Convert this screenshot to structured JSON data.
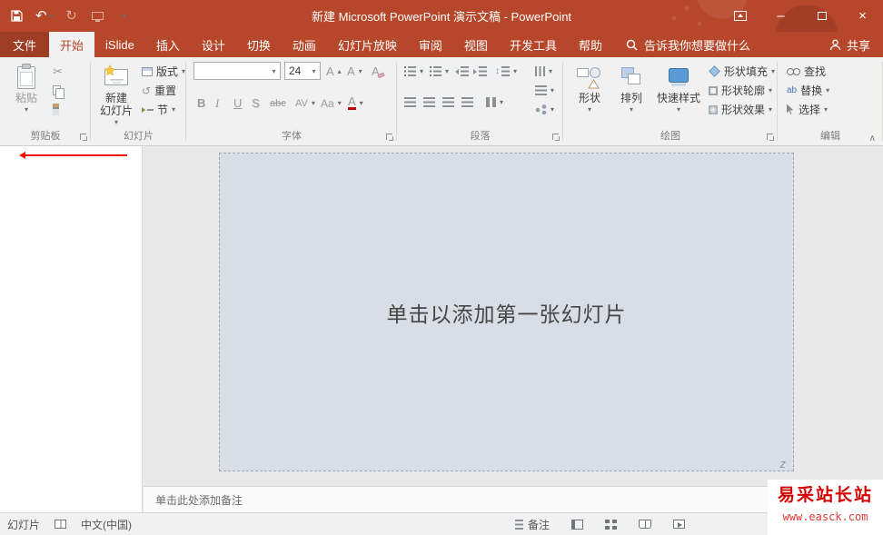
{
  "titlebar": {
    "title": "新建 Microsoft PowerPoint 演示文稿 - PowerPoint"
  },
  "window_controls": {
    "minimize": "–",
    "close": "×"
  },
  "tabs": {
    "file": "文件",
    "items": [
      {
        "label": "开始",
        "active": true
      },
      {
        "label": "iSlide"
      },
      {
        "label": "插入"
      },
      {
        "label": "设计"
      },
      {
        "label": "切换"
      },
      {
        "label": "动画"
      },
      {
        "label": "幻灯片放映"
      },
      {
        "label": "审阅"
      },
      {
        "label": "视图"
      },
      {
        "label": "开发工具"
      },
      {
        "label": "帮助"
      }
    ],
    "search_hint": "告诉我你想要做什么",
    "share": "共享"
  },
  "ribbon": {
    "clipboard": {
      "group_label": "剪贴板",
      "paste": "粘贴"
    },
    "slides": {
      "group_label": "幻灯片",
      "new_slide": "新建\n幻灯片",
      "layout": "版式",
      "reset": "重置",
      "section": "节"
    },
    "font": {
      "group_label": "字体",
      "name_value": "",
      "size_value": "24",
      "grow_font": "A",
      "shrink_font": "A",
      "clear_format": "A",
      "bold": "B",
      "italic": "I",
      "underline": "U",
      "text_shadow": "S",
      "strikethrough": "abc",
      "char_spacing": "AV",
      "change_case": "Aa",
      "font_color": "A"
    },
    "paragraph": {
      "group_label": "段落"
    },
    "drawing": {
      "group_label": "绘图",
      "shapes": "形状",
      "arrange": "排列",
      "quick_styles": "快速样式",
      "shape_fill": "形状填充",
      "shape_outline": "形状轮廓",
      "shape_effects": "形状效果"
    },
    "editing": {
      "group_label": "编辑",
      "find": "查找",
      "replace": "替换",
      "select": "选择"
    }
  },
  "editor": {
    "slide_placeholder": "单击以添加第一张幻灯片",
    "notes_placeholder": "单击此处添加备注",
    "corner_glyph": "z"
  },
  "statusbar": {
    "slide_indicator": "幻灯片",
    "language": "中文(中国)",
    "notes_button": "备注"
  },
  "watermark": {
    "title": "易采站长站",
    "url": "www.easck.com"
  },
  "icons": {
    "caret_down": "▾",
    "caret_up": "▴",
    "undo": "↶",
    "redo": "↻",
    "reset": "↺",
    "scissors": "✂",
    "updown": "↕",
    "collapse_ribbon": "∧",
    "replace_glyph": "ab"
  },
  "colors": {
    "accent": "#B7472A",
    "canvas": "#D9DDE5",
    "watermark_red": "#D50000"
  }
}
